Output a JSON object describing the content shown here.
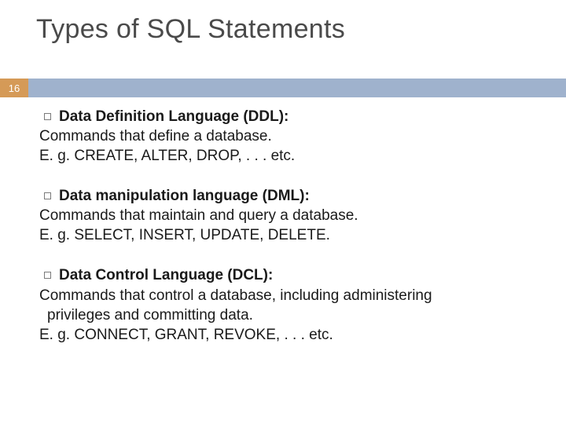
{
  "slide": {
    "title": "Types of SQL Statements",
    "number": "16"
  },
  "items": [
    {
      "heading": "Data Definition Language (DDL):",
      "line1": "Commands that define a database.",
      "line2": "E. g. CREATE, ALTER, DROP, . . . etc."
    },
    {
      "heading": "Data manipulation language (DML):",
      "line1": "Commands that maintain and query a database.",
      "line2": "E. g. SELECT, INSERT, UPDATE, DELETE."
    },
    {
      "heading": "Data Control Language (DCL):",
      "line1": "Commands that control a database, including administering",
      "line1b": "privileges and committing data.",
      "line2": "E. g. CONNECT, GRANT, REVOKE, . . . etc."
    }
  ]
}
